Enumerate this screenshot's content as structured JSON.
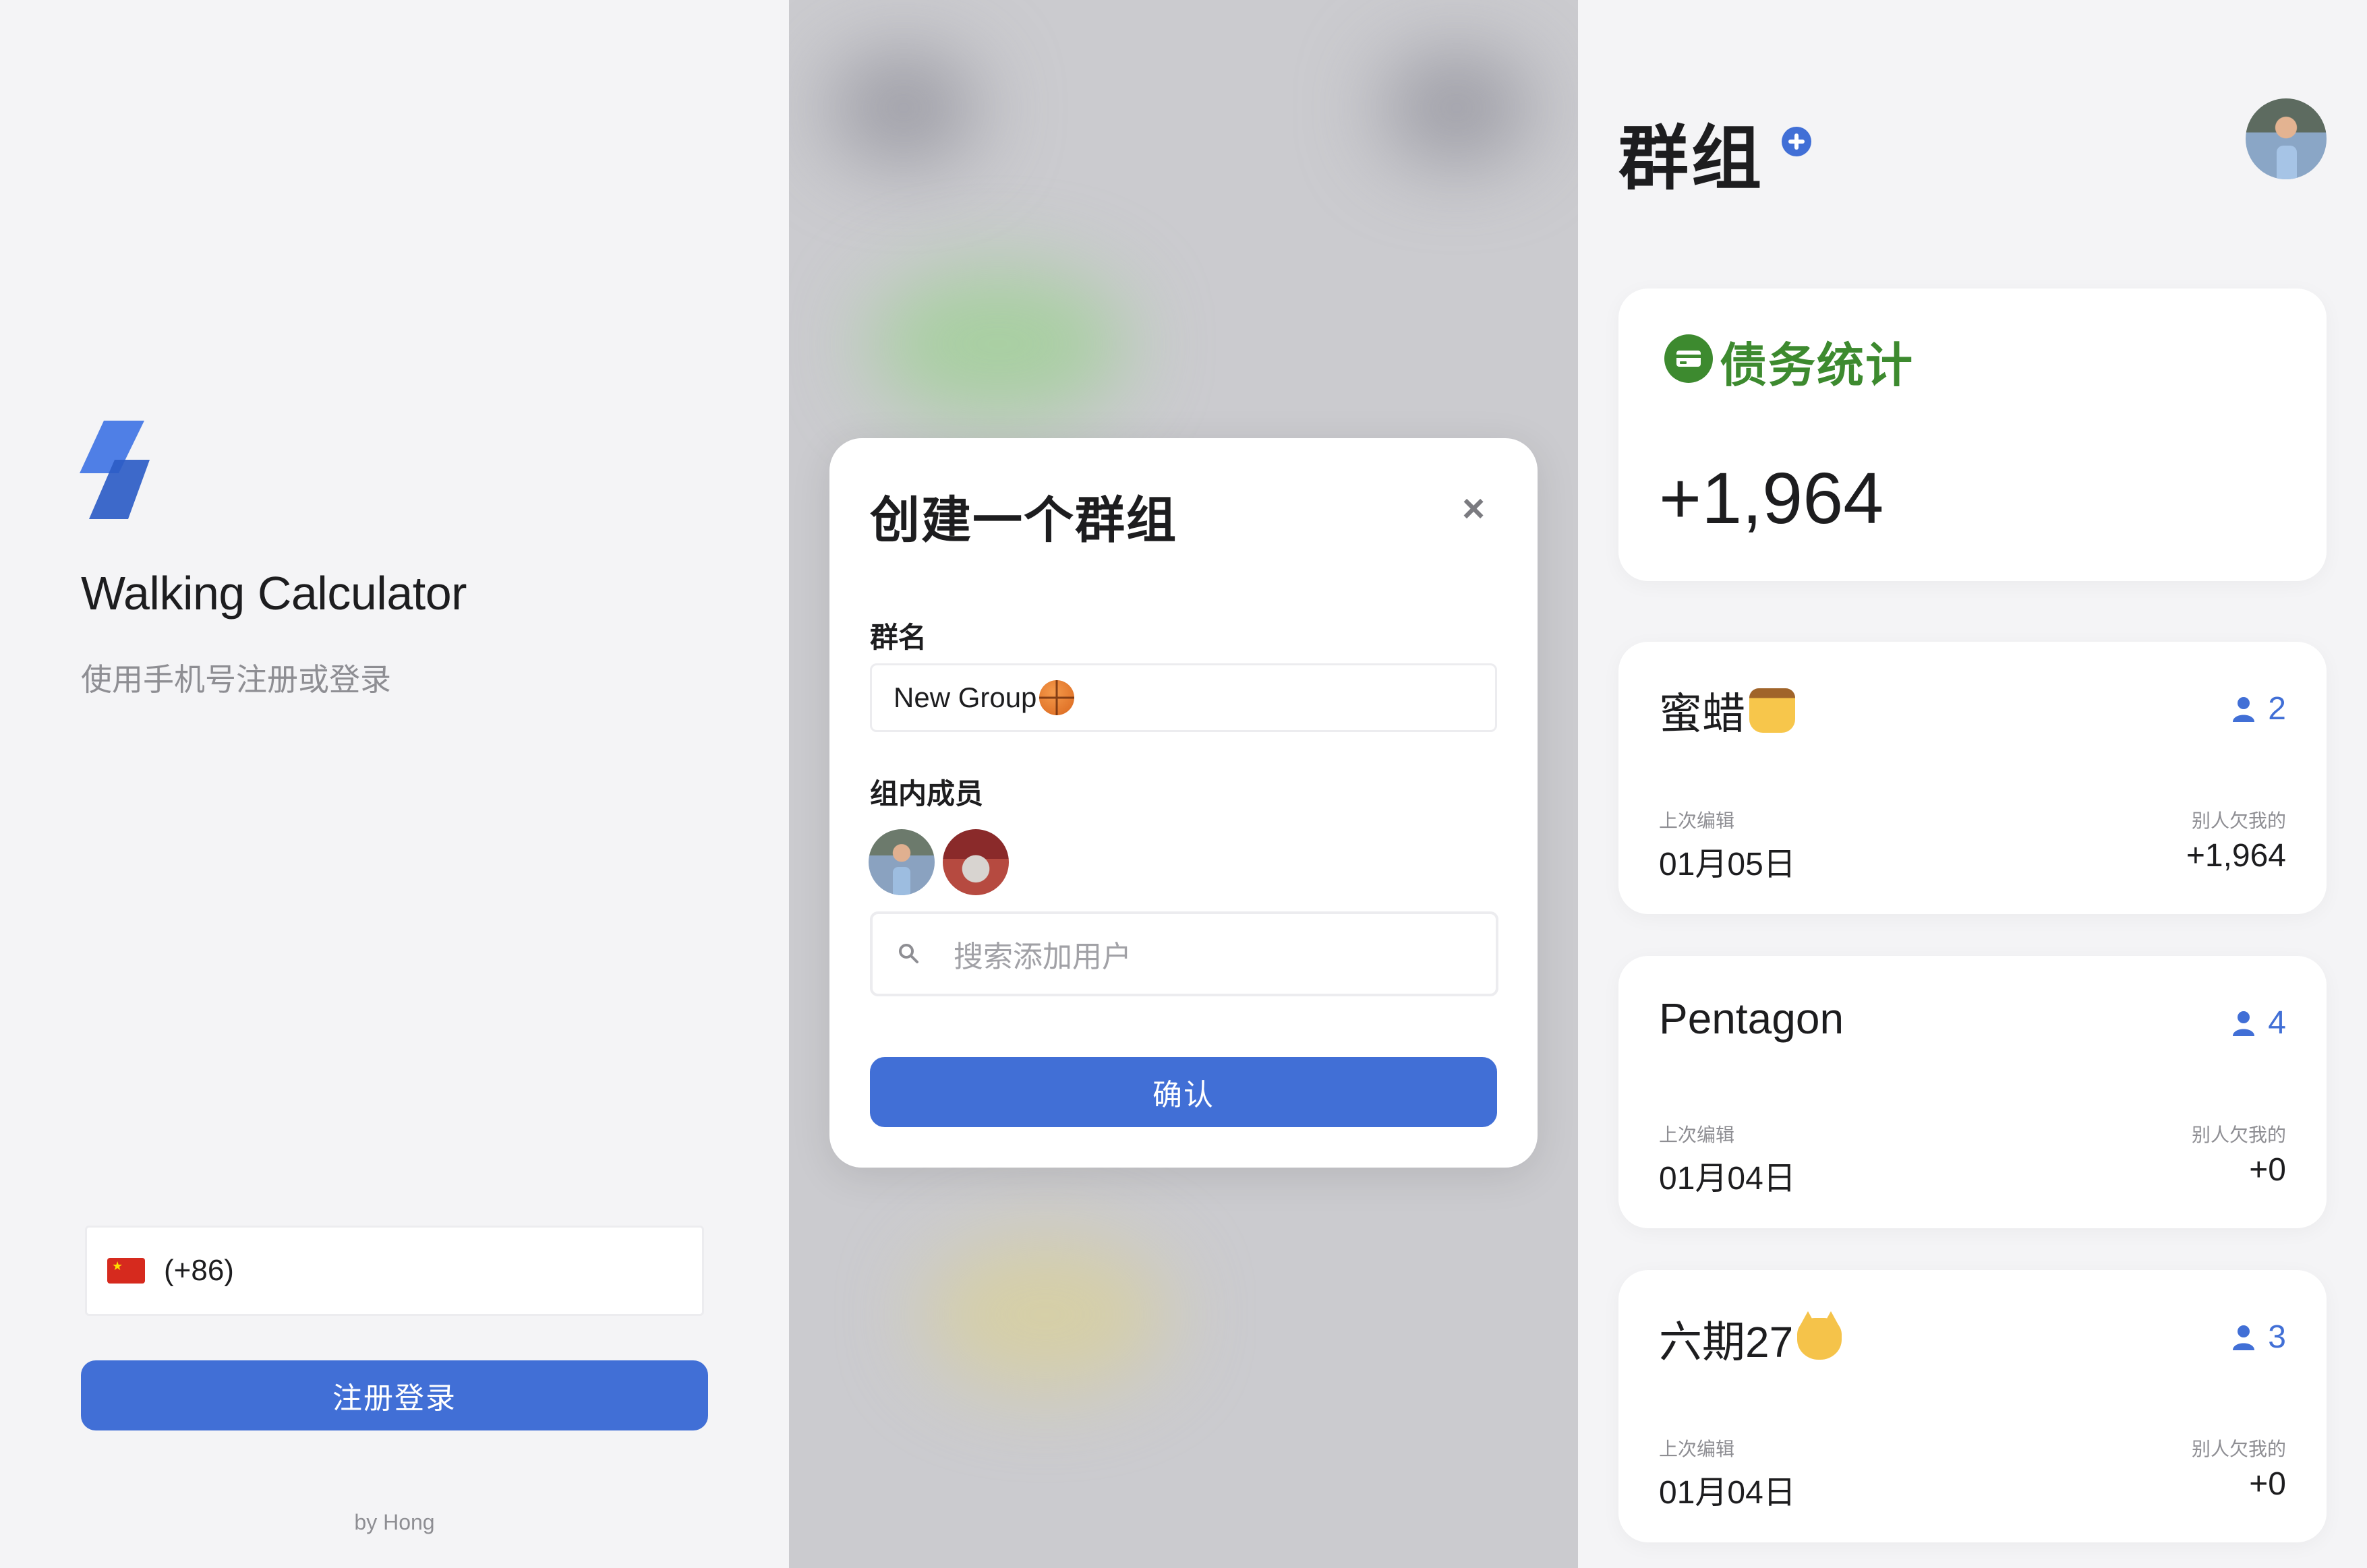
{
  "login": {
    "app_title": "Walking Calculator",
    "subtitle": "使用手机号注册或登录",
    "country_flag": "china-flag",
    "country_code": "(+86)",
    "submit_label": "注册登录",
    "byline": "by Hong",
    "accent_color": "#416fd6"
  },
  "modal": {
    "title": "创建一个群组",
    "close_label": "×",
    "name_label": "群名",
    "name_value": "New Group",
    "name_emoji": "basketball",
    "members_label": "组内成员",
    "members": [
      "avatar-user-1",
      "avatar-user-2"
    ],
    "search_placeholder": "搜索添加用户",
    "confirm_label": "确认"
  },
  "groups": {
    "title": "群组",
    "debt_title": "债务统计",
    "debt_total": "+1,964",
    "debt_color": "#3d8a2f",
    "items": [
      {
        "name": "蜜蜡",
        "emoji": "honey-pot",
        "members": "2",
        "edited_label": "上次编辑",
        "date": "01月05日",
        "owed_label": "别人欠我的",
        "owed": "+1,964"
      },
      {
        "name": "Pentagon",
        "emoji": "",
        "members": "4",
        "edited_label": "上次编辑",
        "date": "01月04日",
        "owed_label": "别人欠我的",
        "owed": "+0"
      },
      {
        "name": "六期27",
        "emoji": "cat-face",
        "members": "3",
        "edited_label": "上次编辑",
        "date": "01月04日",
        "owed_label": "别人欠我的",
        "owed": "+0"
      }
    ]
  }
}
